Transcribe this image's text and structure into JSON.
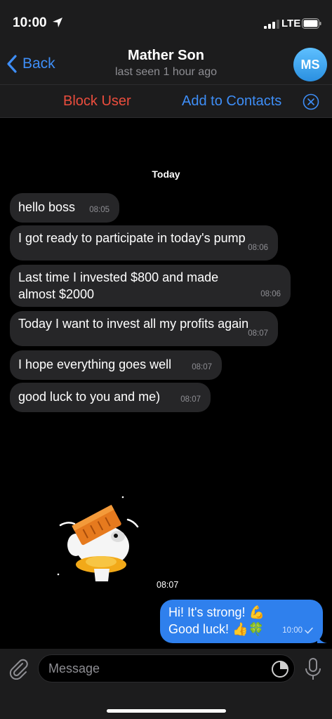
{
  "status": {
    "time": "10:00",
    "network": "LTE"
  },
  "nav": {
    "back_label": "Back",
    "title": "Mather Son",
    "subtitle": "last seen 1 hour ago",
    "avatar_initials": "MS"
  },
  "actions": {
    "block_label": "Block User",
    "add_label": "Add to Contacts"
  },
  "chat": {
    "date_label": "Today",
    "messages": [
      {
        "text": "hello boss",
        "time": "08:05"
      },
      {
        "text": "I got ready to participate in today's pump",
        "time": "08:06"
      },
      {
        "text": "Last time I invested $800 and made almost $2000",
        "time": "08:06"
      },
      {
        "text": "Today I want to invest all my profits again",
        "time": "08:07"
      },
      {
        "text": "I hope everything goes well",
        "time": "08:07"
      },
      {
        "text": "good luck to you and me)",
        "time": "08:07"
      }
    ],
    "sticker_time": "08:07",
    "outgoing": {
      "line1": "Hi! It's strong! 💪",
      "line2": "Good luck! 👍🍀",
      "time": "10:00"
    }
  },
  "input": {
    "placeholder": "Message"
  },
  "colors": {
    "accent": "#3e8ef7",
    "danger": "#eb4d3d",
    "outgoing_bubble": "#2f80ed",
    "incoming_bubble": "#262628"
  }
}
